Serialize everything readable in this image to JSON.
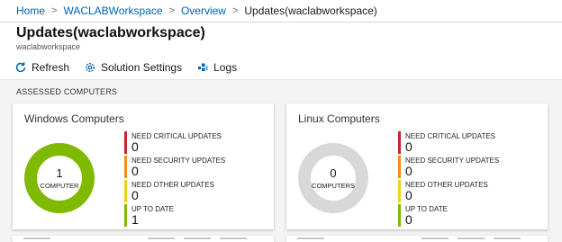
{
  "breadcrumb": {
    "items": [
      {
        "label": "Home"
      },
      {
        "label": "WACLABWorkspace"
      },
      {
        "label": "Overview"
      }
    ],
    "current": "Updates(waclabworkspace)"
  },
  "header": {
    "title": "Updates(waclabworkspace)",
    "subtitle": "waclabworkspace"
  },
  "toolbar": {
    "refresh_label": "Refresh",
    "settings_label": "Solution Settings",
    "logs_label": "Logs"
  },
  "section_label": "ASSESSED COMPUTERS",
  "colors": {
    "critical": "#c4262e",
    "security": "#f08c1b",
    "other": "#f0d21a",
    "up_to_date": "#7fba00",
    "empty_ring": "#d8d8d8",
    "link": "#0062ad"
  },
  "windows_card": {
    "title": "Windows Computers",
    "total": "1",
    "total_caption": "COMPUTER",
    "legend": [
      {
        "label": "NEED CRITICAL UPDATES",
        "value": "0"
      },
      {
        "label": "NEED SECURITY UPDATES",
        "value": "0"
      },
      {
        "label": "NEED OTHER UPDATES",
        "value": "0"
      },
      {
        "label": "UP TO DATE",
        "value": "1"
      }
    ]
  },
  "linux_card": {
    "title": "Linux Computers",
    "total": "0",
    "total_caption": "COMPUTERS",
    "legend": [
      {
        "label": "NEED CRITICAL UPDATES",
        "value": "0"
      },
      {
        "label": "NEED SECURITY UPDATES",
        "value": "0"
      },
      {
        "label": "NEED OTHER UPDATES",
        "value": "0"
      },
      {
        "label": "UP TO DATE",
        "value": "0"
      }
    ]
  }
}
